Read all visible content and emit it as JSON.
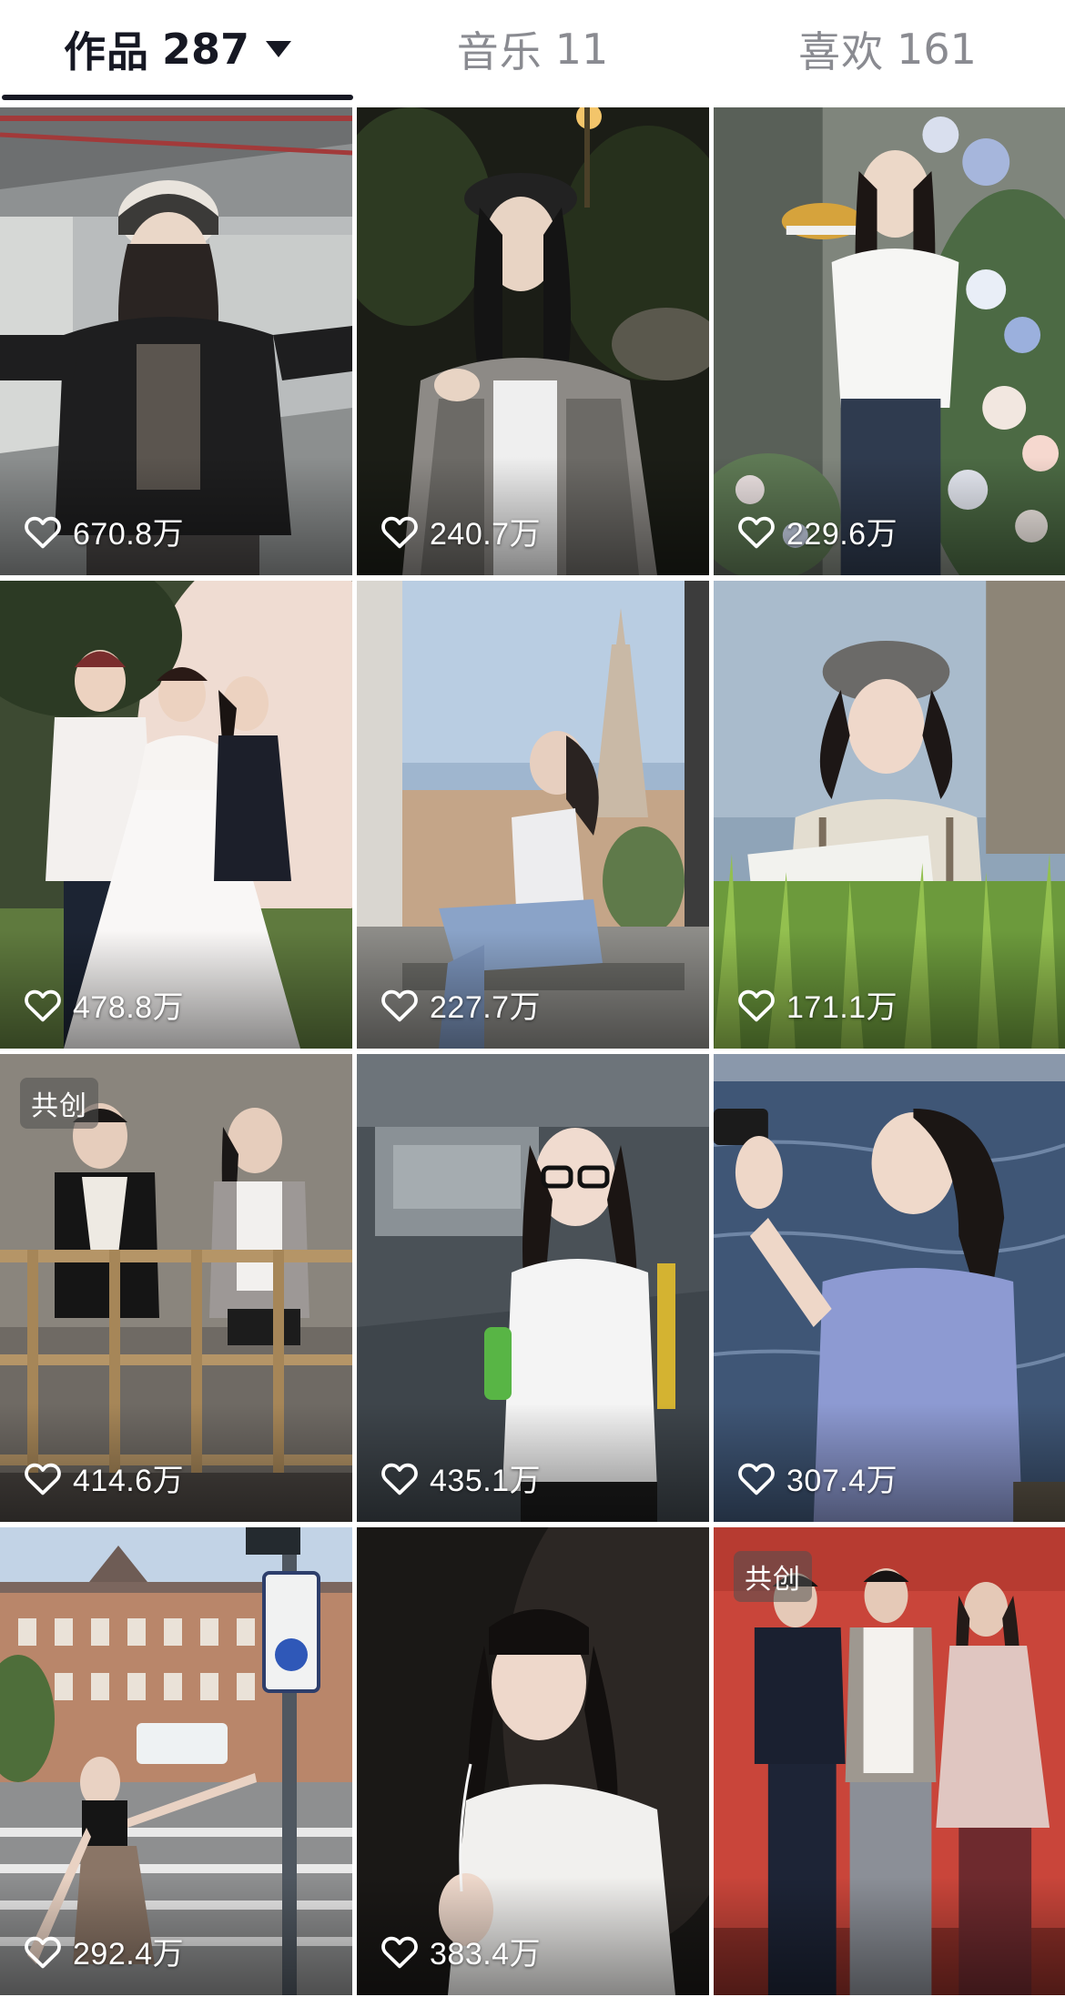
{
  "tabs": [
    {
      "label": "作品",
      "count": "287"
    },
    {
      "label": "音乐",
      "count": "11"
    },
    {
      "label": "喜欢",
      "count": "161"
    }
  ],
  "videos": [
    {
      "likes": "670.8万",
      "badge": ""
    },
    {
      "likes": "240.7万",
      "badge": ""
    },
    {
      "likes": "229.6万",
      "badge": ""
    },
    {
      "likes": "478.8万",
      "badge": ""
    },
    {
      "likes": "227.7万",
      "badge": ""
    },
    {
      "likes": "171.1万",
      "badge": ""
    },
    {
      "likes": "414.6万",
      "badge": "共创"
    },
    {
      "likes": "435.1万",
      "badge": ""
    },
    {
      "likes": "307.4万",
      "badge": ""
    },
    {
      "likes": "292.4万",
      "badge": ""
    },
    {
      "likes": "383.4万",
      "badge": ""
    },
    {
      "likes": "",
      "badge": "共创"
    }
  ],
  "colors": {
    "active_tab": "#161823",
    "inactive_tab": "#8a8b91"
  },
  "icons": {
    "tab_dropdown": "caret-down-icon",
    "like": "heart-outline-icon"
  }
}
